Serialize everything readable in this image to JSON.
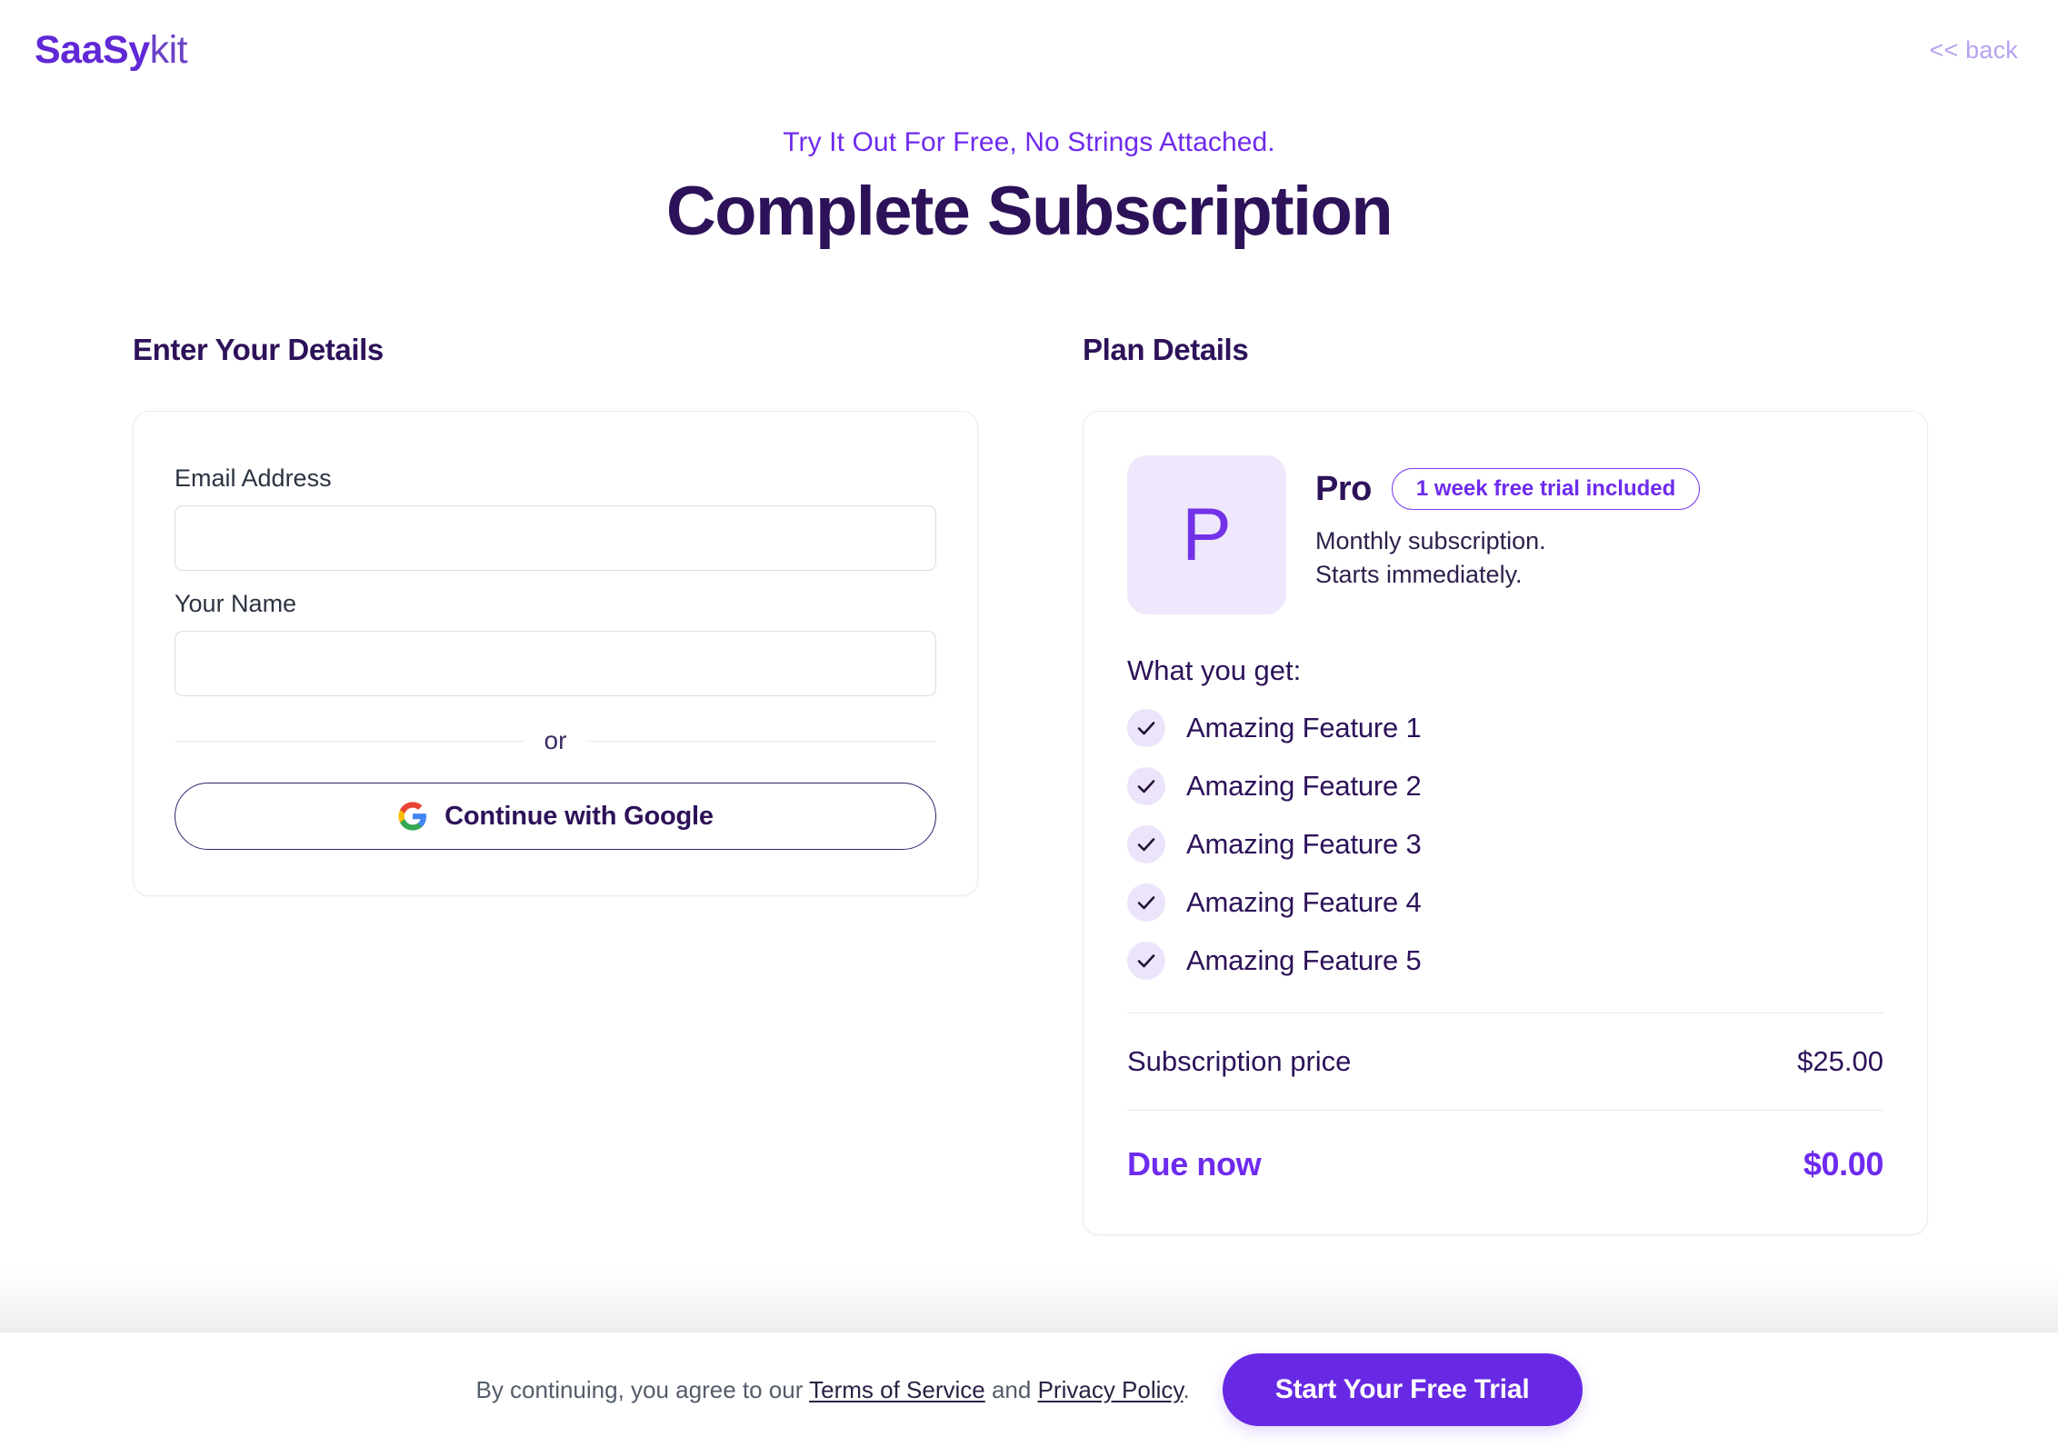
{
  "header": {
    "logo_strong": "SaaSy",
    "logo_light": "kit",
    "back_label": "<< back"
  },
  "hero": {
    "eyebrow": "Try It Out For Free, No Strings Attached.",
    "title": "Complete Subscription"
  },
  "details": {
    "section_title": "Enter Your Details",
    "email_label": "Email Address",
    "email_value": "",
    "email_placeholder": "",
    "name_label": "Your Name",
    "name_value": "",
    "name_placeholder": "",
    "or_text": "or",
    "google_button": "Continue with Google"
  },
  "plan": {
    "section_title": "Plan Details",
    "avatar_letter": "P",
    "name": "Pro",
    "trial_badge": "1 week free trial included",
    "billing_line_1": "Monthly subscription.",
    "billing_line_2": "Starts immediately.",
    "features_heading": "What you get:",
    "features": [
      "Amazing Feature 1",
      "Amazing Feature 2",
      "Amazing Feature 3",
      "Amazing Feature 4",
      "Amazing Feature 5"
    ],
    "price_label": "Subscription price",
    "price_value": "$25.00",
    "due_label": "Due now",
    "due_value": "$0.00"
  },
  "footer": {
    "consent_prefix": "By continuing, you agree to our ",
    "terms_link": "Terms of Service",
    "consent_middle": " and ",
    "privacy_link": "Privacy Policy",
    "consent_suffix": ".",
    "cta_label": "Start Your Free Trial"
  },
  "colors": {
    "brand_purple": "#6e2bee",
    "deep_indigo": "#2d1259",
    "badge_border": "#7a3df0",
    "avatar_bg": "#efe7fb",
    "check_bg": "#ece4fa",
    "cta_bg": "#6729e3",
    "back_link": "#b9a2ef"
  }
}
